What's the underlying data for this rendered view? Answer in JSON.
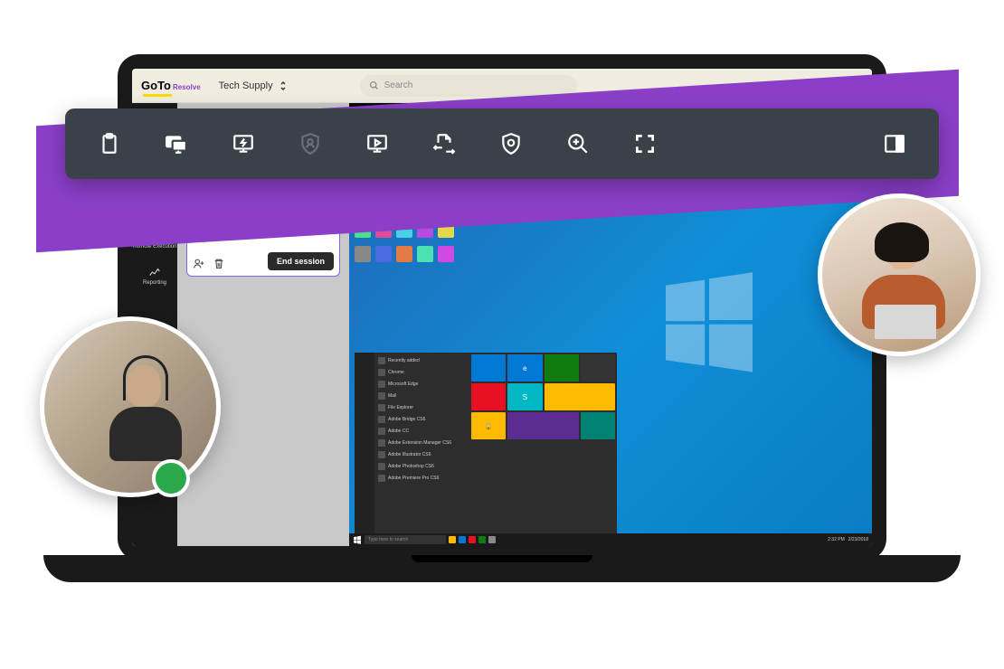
{
  "logo": {
    "brand_go": "Go",
    "brand_to": "To",
    "product": "Resolve"
  },
  "org_selector": {
    "label": "Tech Supply"
  },
  "search": {
    "placeholder": "Search"
  },
  "sidebar": {
    "items": [
      {
        "label": "Remote Execution"
      },
      {
        "label": "Reporting"
      }
    ]
  },
  "session": {
    "end_button": "End session"
  },
  "toolbar": {
    "icons": [
      "clipboard-icon",
      "monitors-icon",
      "power-monitor-icon",
      "shield-user-icon",
      "screen-play-icon",
      "file-transfer-icon",
      "shield-icon",
      "zoom-in-icon",
      "fullscreen-icon"
    ],
    "right_icon": "panel-toggle-icon"
  },
  "start_menu": {
    "list": [
      "Recently added",
      "Chrome",
      "Microsoft Edge",
      "Mail",
      "File Explorer",
      "Adobe Bridge CS6",
      "Adobe CC",
      "Adobe Extension Manager CS6",
      "Adobe Illustrator CS6",
      "Adobe Photoshop CS6",
      "Adobe Premiere Pro CS6"
    ]
  },
  "taskbar": {
    "search_placeholder": "Type here to search",
    "time": "2:32 PM",
    "date": "2/23/2018"
  },
  "status": {
    "agent_online": true
  },
  "colors": {
    "accent_purple": "#8b3fc9",
    "toolbar_bg": "#3a4148",
    "status_green": "#2ba84a",
    "win_blue": "#0f8fd8"
  }
}
